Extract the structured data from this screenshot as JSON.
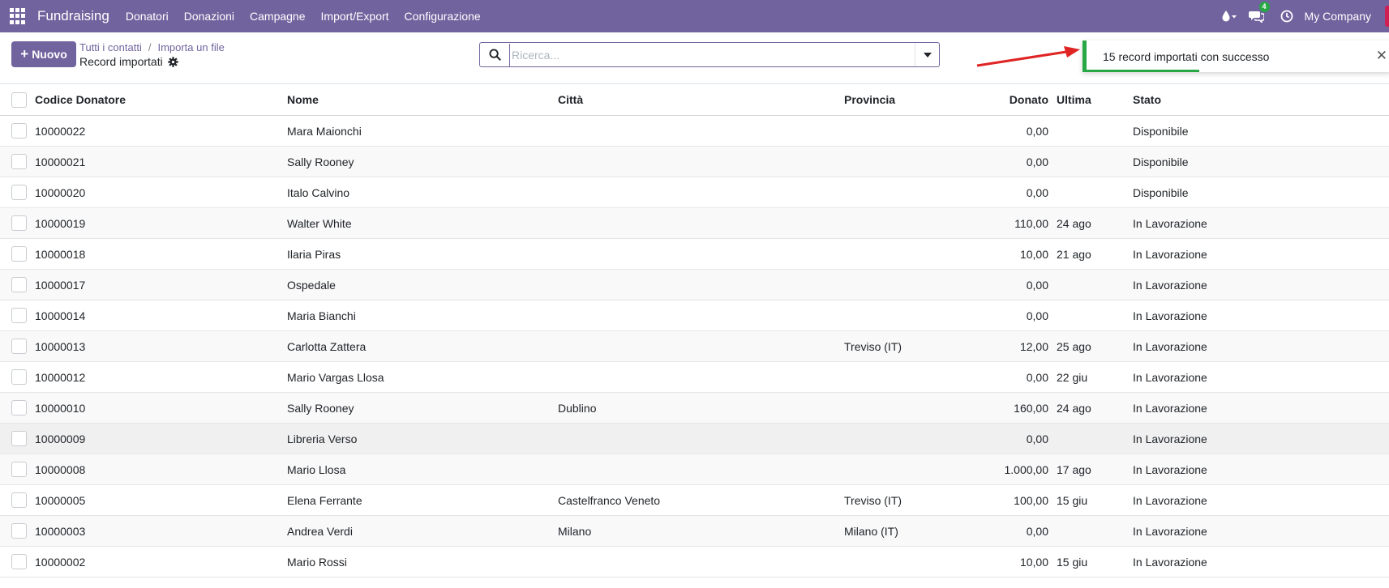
{
  "navbar": {
    "app_name": "Fundraising",
    "menu": [
      "Donatori",
      "Donazioni",
      "Campagne",
      "Import/Export",
      "Configurazione"
    ],
    "messages_count": "4",
    "company": "My Company"
  },
  "control": {
    "new_button": "Nuovo",
    "breadcrumb": [
      "Tutti i contatti",
      "Importa un file"
    ],
    "title": "Record importati",
    "search_placeholder": "Ricerca..."
  },
  "toast": {
    "message": "15 record importati con successo",
    "progress": 0.37
  },
  "table": {
    "columns": [
      "Codice Donatore",
      "Nome",
      "Città",
      "Provincia",
      "Donato",
      "Ultima",
      "Stato"
    ],
    "rows": [
      {
        "code": "10000022",
        "name": "Mara Maionchi",
        "city": "",
        "province": "",
        "donated": "0,00",
        "last": "",
        "status": "Disponibile"
      },
      {
        "code": "10000021",
        "name": "Sally Rooney",
        "city": "",
        "province": "",
        "donated": "0,00",
        "last": "",
        "status": "Disponibile"
      },
      {
        "code": "10000020",
        "name": "Italo Calvino",
        "city": "",
        "province": "",
        "donated": "0,00",
        "last": "",
        "status": "Disponibile"
      },
      {
        "code": "10000019",
        "name": "Walter White",
        "city": "",
        "province": "",
        "donated": "110,00",
        "last": "24 ago",
        "status": "In Lavorazione"
      },
      {
        "code": "10000018",
        "name": "Ilaria Piras",
        "city": "",
        "province": "",
        "donated": "10,00",
        "last": "21 ago",
        "status": "In Lavorazione"
      },
      {
        "code": "10000017",
        "name": "Ospedale",
        "city": "",
        "province": "",
        "donated": "0,00",
        "last": "",
        "status": "In Lavorazione"
      },
      {
        "code": "10000014",
        "name": "Maria Bianchi",
        "city": "",
        "province": "",
        "donated": "0,00",
        "last": "",
        "status": "In Lavorazione"
      },
      {
        "code": "10000013",
        "name": "Carlotta Zattera",
        "city": "",
        "province": "Treviso (IT)",
        "donated": "12,00",
        "last": "25 ago",
        "status": "In Lavorazione"
      },
      {
        "code": "10000012",
        "name": "Mario Vargas Llosa",
        "city": "",
        "province": "",
        "donated": "0,00",
        "last": "22 giu",
        "status": "In Lavorazione"
      },
      {
        "code": "10000010",
        "name": "Sally Rooney",
        "city": "Dublino",
        "province": "",
        "donated": "160,00",
        "last": "24 ago",
        "status": "In Lavorazione"
      },
      {
        "code": "10000009",
        "name": "Libreria Verso",
        "city": "",
        "province": "",
        "donated": "0,00",
        "last": "",
        "status": "In Lavorazione"
      },
      {
        "code": "10000008",
        "name": "Mario Llosa",
        "city": "",
        "province": "",
        "donated": "1.000,00",
        "last": "17 ago",
        "status": "In Lavorazione"
      },
      {
        "code": "10000005",
        "name": "Elena Ferrante",
        "city": "Castelfranco Veneto",
        "province": "Treviso (IT)",
        "donated": "100,00",
        "last": "15 giu",
        "status": "In Lavorazione"
      },
      {
        "code": "10000003",
        "name": "Andrea Verdi",
        "city": "Milano",
        "province": "Milano (IT)",
        "donated": "0,00",
        "last": "",
        "status": "In Lavorazione"
      },
      {
        "code": "10000002",
        "name": "Mario Rossi",
        "city": "",
        "province": "",
        "donated": "10,00",
        "last": "15 giu",
        "status": "In Lavorazione"
      }
    ]
  },
  "colors": {
    "brand": "#71639e",
    "success": "#28a745",
    "annotation_arrow": "#e02424"
  },
  "icons": [
    "apps-grid-icon",
    "droplet-icon",
    "chat-icon",
    "clock-icon",
    "gear-icon",
    "search-icon",
    "caret-down-icon",
    "close-icon"
  ]
}
